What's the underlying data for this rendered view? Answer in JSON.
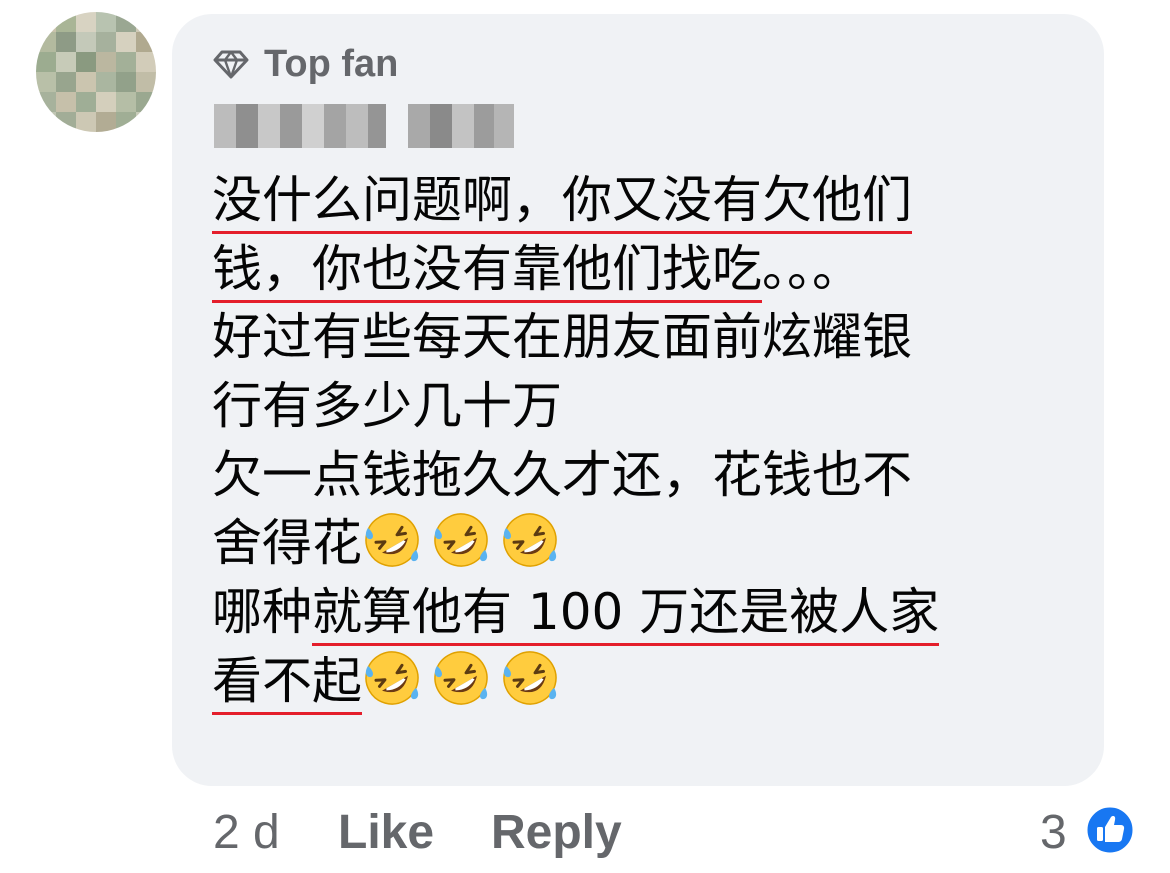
{
  "comment": {
    "badge_label": "Top fan",
    "lines": [
      [
        "没什么问题啊，你又没有欠他们"
      ],
      [
        "钱，你也没有靠他们找吃",
        "。。。"
      ],
      [
        "好过有些每天在朋友面前炫耀银"
      ],
      [
        "行有多少几十万"
      ],
      [
        "欠一点钱拖久久才还，花钱也不"
      ],
      [
        "舍得花"
      ],
      [
        "哪种",
        "就算他有 100 万还是被人家"
      ],
      [
        "看不起"
      ]
    ],
    "emoji": [
      "rolling-on-floor-laughing",
      "rolling-on-floor-laughing",
      "rolling-on-floor-laughing"
    ]
  },
  "actions": {
    "timestamp": "2 d",
    "like_label": "Like",
    "reply_label": "Reply",
    "reaction_count": "3",
    "reaction_icon": "thumbs-up-icon"
  },
  "colors": {
    "bubble": "#f0f2f5",
    "secondary_text": "#65676b",
    "underline": "#e41e2b",
    "like_blue": "#1877f2"
  }
}
